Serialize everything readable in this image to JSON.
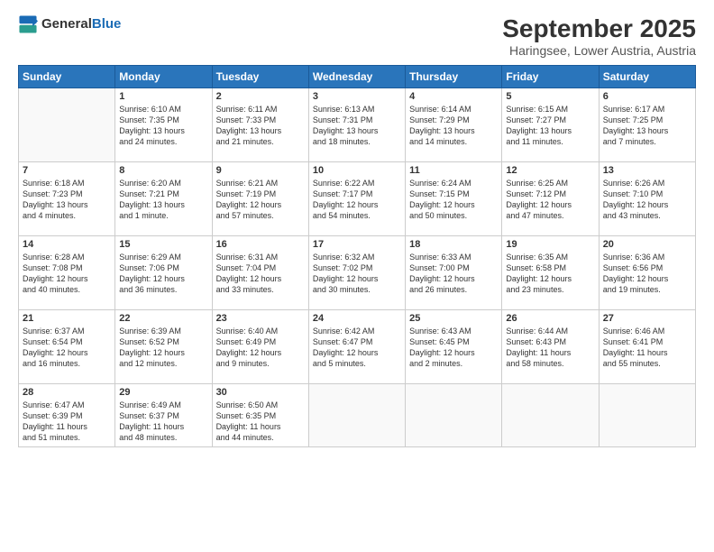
{
  "logo": {
    "general": "General",
    "blue": "Blue"
  },
  "title": "September 2025",
  "subtitle": "Haringsee, Lower Austria, Austria",
  "weekdays": [
    "Sunday",
    "Monday",
    "Tuesday",
    "Wednesday",
    "Thursday",
    "Friday",
    "Saturday"
  ],
  "weeks": [
    [
      {
        "day": "",
        "info": ""
      },
      {
        "day": "1",
        "info": "Sunrise: 6:10 AM\nSunset: 7:35 PM\nDaylight: 13 hours\nand 24 minutes."
      },
      {
        "day": "2",
        "info": "Sunrise: 6:11 AM\nSunset: 7:33 PM\nDaylight: 13 hours\nand 21 minutes."
      },
      {
        "day": "3",
        "info": "Sunrise: 6:13 AM\nSunset: 7:31 PM\nDaylight: 13 hours\nand 18 minutes."
      },
      {
        "day": "4",
        "info": "Sunrise: 6:14 AM\nSunset: 7:29 PM\nDaylight: 13 hours\nand 14 minutes."
      },
      {
        "day": "5",
        "info": "Sunrise: 6:15 AM\nSunset: 7:27 PM\nDaylight: 13 hours\nand 11 minutes."
      },
      {
        "day": "6",
        "info": "Sunrise: 6:17 AM\nSunset: 7:25 PM\nDaylight: 13 hours\nand 7 minutes."
      }
    ],
    [
      {
        "day": "7",
        "info": "Sunrise: 6:18 AM\nSunset: 7:23 PM\nDaylight: 13 hours\nand 4 minutes."
      },
      {
        "day": "8",
        "info": "Sunrise: 6:20 AM\nSunset: 7:21 PM\nDaylight: 13 hours\nand 1 minute."
      },
      {
        "day": "9",
        "info": "Sunrise: 6:21 AM\nSunset: 7:19 PM\nDaylight: 12 hours\nand 57 minutes."
      },
      {
        "day": "10",
        "info": "Sunrise: 6:22 AM\nSunset: 7:17 PM\nDaylight: 12 hours\nand 54 minutes."
      },
      {
        "day": "11",
        "info": "Sunrise: 6:24 AM\nSunset: 7:15 PM\nDaylight: 12 hours\nand 50 minutes."
      },
      {
        "day": "12",
        "info": "Sunrise: 6:25 AM\nSunset: 7:12 PM\nDaylight: 12 hours\nand 47 minutes."
      },
      {
        "day": "13",
        "info": "Sunrise: 6:26 AM\nSunset: 7:10 PM\nDaylight: 12 hours\nand 43 minutes."
      }
    ],
    [
      {
        "day": "14",
        "info": "Sunrise: 6:28 AM\nSunset: 7:08 PM\nDaylight: 12 hours\nand 40 minutes."
      },
      {
        "day": "15",
        "info": "Sunrise: 6:29 AM\nSunset: 7:06 PM\nDaylight: 12 hours\nand 36 minutes."
      },
      {
        "day": "16",
        "info": "Sunrise: 6:31 AM\nSunset: 7:04 PM\nDaylight: 12 hours\nand 33 minutes."
      },
      {
        "day": "17",
        "info": "Sunrise: 6:32 AM\nSunset: 7:02 PM\nDaylight: 12 hours\nand 30 minutes."
      },
      {
        "day": "18",
        "info": "Sunrise: 6:33 AM\nSunset: 7:00 PM\nDaylight: 12 hours\nand 26 minutes."
      },
      {
        "day": "19",
        "info": "Sunrise: 6:35 AM\nSunset: 6:58 PM\nDaylight: 12 hours\nand 23 minutes."
      },
      {
        "day": "20",
        "info": "Sunrise: 6:36 AM\nSunset: 6:56 PM\nDaylight: 12 hours\nand 19 minutes."
      }
    ],
    [
      {
        "day": "21",
        "info": "Sunrise: 6:37 AM\nSunset: 6:54 PM\nDaylight: 12 hours\nand 16 minutes."
      },
      {
        "day": "22",
        "info": "Sunrise: 6:39 AM\nSunset: 6:52 PM\nDaylight: 12 hours\nand 12 minutes."
      },
      {
        "day": "23",
        "info": "Sunrise: 6:40 AM\nSunset: 6:49 PM\nDaylight: 12 hours\nand 9 minutes."
      },
      {
        "day": "24",
        "info": "Sunrise: 6:42 AM\nSunset: 6:47 PM\nDaylight: 12 hours\nand 5 minutes."
      },
      {
        "day": "25",
        "info": "Sunrise: 6:43 AM\nSunset: 6:45 PM\nDaylight: 12 hours\nand 2 minutes."
      },
      {
        "day": "26",
        "info": "Sunrise: 6:44 AM\nSunset: 6:43 PM\nDaylight: 11 hours\nand 58 minutes."
      },
      {
        "day": "27",
        "info": "Sunrise: 6:46 AM\nSunset: 6:41 PM\nDaylight: 11 hours\nand 55 minutes."
      }
    ],
    [
      {
        "day": "28",
        "info": "Sunrise: 6:47 AM\nSunset: 6:39 PM\nDaylight: 11 hours\nand 51 minutes."
      },
      {
        "day": "29",
        "info": "Sunrise: 6:49 AM\nSunset: 6:37 PM\nDaylight: 11 hours\nand 48 minutes."
      },
      {
        "day": "30",
        "info": "Sunrise: 6:50 AM\nSunset: 6:35 PM\nDaylight: 11 hours\nand 44 minutes."
      },
      {
        "day": "",
        "info": ""
      },
      {
        "day": "",
        "info": ""
      },
      {
        "day": "",
        "info": ""
      },
      {
        "day": "",
        "info": ""
      }
    ]
  ]
}
